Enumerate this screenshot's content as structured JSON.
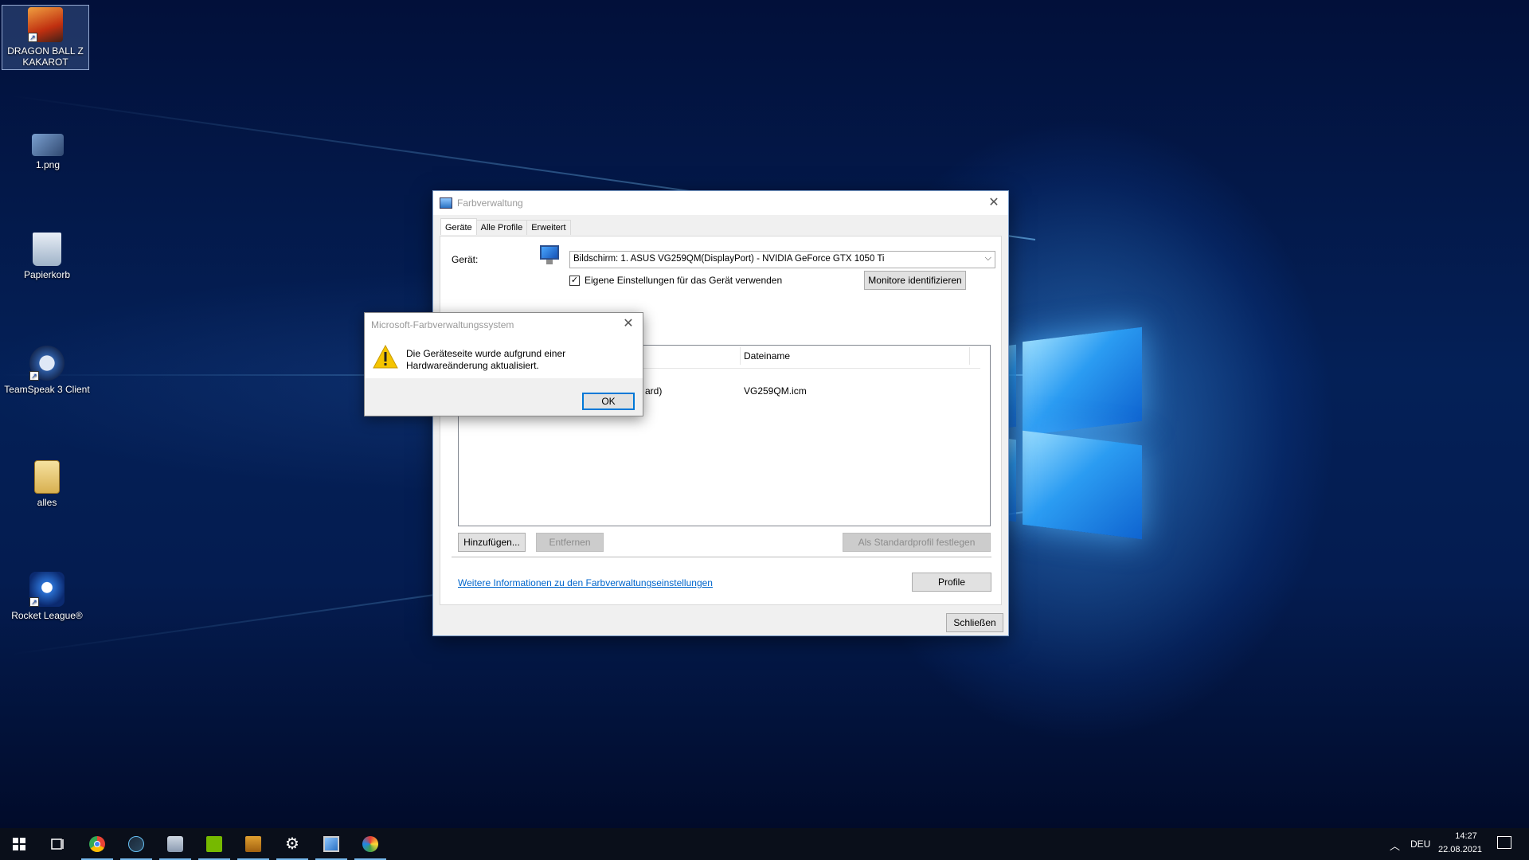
{
  "desktop": {
    "icons": [
      {
        "label_line1": "DRAGON BALL Z",
        "label_line2": "KAKAROT"
      },
      {
        "label_line1": "1.png",
        "label_line2": ""
      },
      {
        "label_line1": "Papierkorb",
        "label_line2": ""
      },
      {
        "label_line1": "TeamSpeak 3 Client",
        "label_line2": ""
      },
      {
        "label_line1": "alles",
        "label_line2": ""
      },
      {
        "label_line1": "Rocket League®",
        "label_line2": ""
      }
    ]
  },
  "dialog": {
    "title": "Farbverwaltung",
    "tabs": [
      "Geräte",
      "Alle Profile",
      "Erweitert"
    ],
    "device_label": "Gerät:",
    "device_value": "Bildschirm: 1. ASUS VG259QM(DisplayPort) - NVIDIA GeForce GTX 1050 Ti",
    "checkbox_label": "Eigene Einstellungen für das Gerät verwenden",
    "checkbox_checked": "✓",
    "identify_button": "Monitore identifizieren",
    "list": {
      "columns": [
        "",
        "Dateiname"
      ],
      "rows": [
        {
          "name_fragment": "ard)",
          "file": "VG259QM.icm"
        }
      ]
    },
    "add_button": "Hinzufügen...",
    "remove_button": "Entfernen",
    "default_button": "Als Standardprofil festlegen",
    "info_link": "Weitere Informationen zu den Farbverwaltungseinstellungen",
    "profiles_button": "Profile",
    "close_button": "Schließen"
  },
  "msgbox": {
    "title": "Microsoft-Farbverwaltungssystem",
    "line1": "Die Geräteseite wurde aufgrund einer",
    "line2": "Hardwareänderung aktualisiert.",
    "ok_button": "OK"
  },
  "taskbar": {
    "language": "DEU",
    "time": "14:27",
    "date": "22.08.2021"
  },
  "colors": {
    "accent": "#0078d7",
    "link": "#0066cc",
    "taskbar": "#0a0f1a",
    "warning": "#f5c400"
  }
}
